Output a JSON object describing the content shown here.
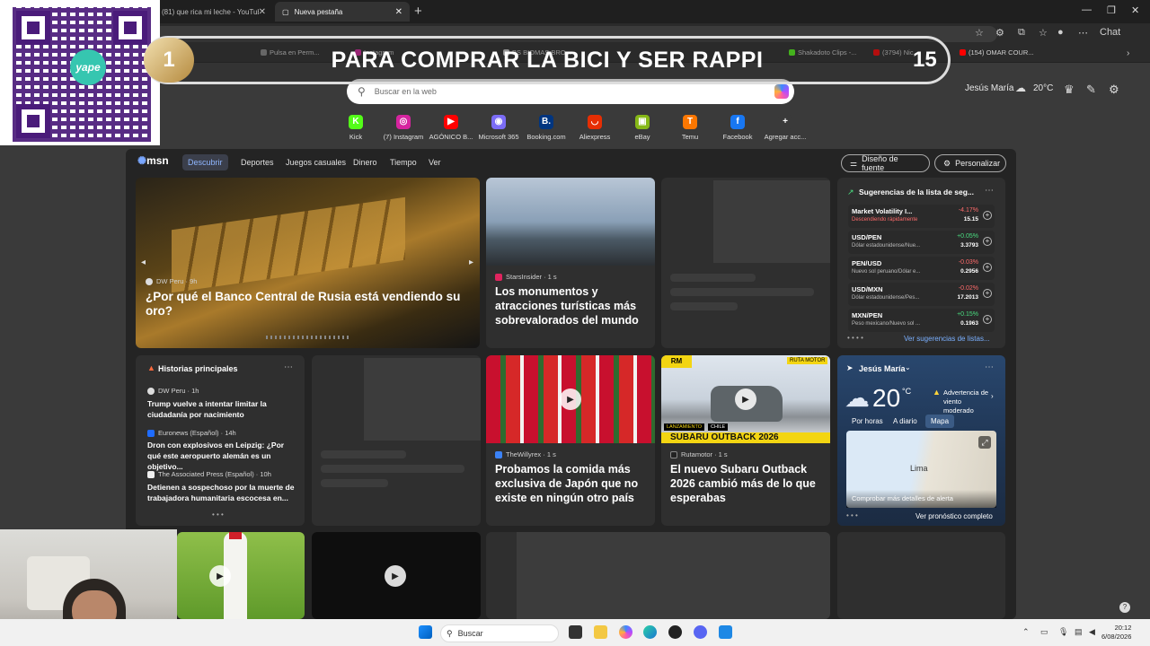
{
  "tabs": [
    {
      "label": "(81) que rica mi leche - YouTube",
      "active": false
    },
    {
      "label": "Nueva pestaña",
      "active": true
    }
  ],
  "favorites": [
    "Pulsa en Perm...",
    "Instagram",
    "BS BIOMAS BRO...",
    "Shakadoto Clips -...",
    "(3794) Nic...",
    "(154) OMAR COUR..."
  ],
  "overlay": {
    "banner_text": "PARA COMPRAR LA BICI Y SER RAPPI",
    "banner_left": "1",
    "banner_right": "15",
    "yape": "yape"
  },
  "search": {
    "placeholder": "Buscar en la web"
  },
  "header": {
    "location": "Jesús María",
    "temp": "20°C"
  },
  "quicklinks": [
    {
      "label": "Kick",
      "color": "#53fc18",
      "glyph": "K"
    },
    {
      "label": "(7) Instagram",
      "color": "#d6249f",
      "glyph": "◎"
    },
    {
      "label": "AGÓNICO B...",
      "color": "#ff0000",
      "glyph": "▶"
    },
    {
      "label": "Microsoft 365",
      "color": "#7b6cf6",
      "glyph": "◉"
    },
    {
      "label": "Booking.com",
      "color": "#003580",
      "glyph": "B."
    },
    {
      "label": "Aliexpress",
      "color": "#e62e04",
      "glyph": "◡"
    },
    {
      "label": "eBay",
      "color": "#86b817",
      "glyph": "▣"
    },
    {
      "label": "Temu",
      "color": "#fb7701",
      "glyph": "T"
    },
    {
      "label": "Facebook",
      "color": "#1877f2",
      "glyph": "f"
    },
    {
      "label": "Agregar acc...",
      "color": "#3a3a3a",
      "glyph": "+"
    }
  ],
  "msn": {
    "logo": "msn",
    "nav": [
      "Descubrir",
      "Deportes",
      "Juegos casuales",
      "Dinero",
      "Tiempo",
      "Ver"
    ],
    "design_btn": "Diseño de fuente",
    "personalize_btn": "Personalizar"
  },
  "hero": {
    "source": "DW Peru · 9h",
    "title": "¿Por qué el Banco Central de Rusia está vendiendo su oro?"
  },
  "card1": {
    "source": "StarsInsider · 1 s",
    "title": "Los monumentos y atracciones turísticas más sobrevalorados del mundo"
  },
  "watchlist": {
    "title": "Sugerencias de la lista de seg...",
    "items": [
      {
        "name": "Market Volatility I...",
        "sub": "Descendiendo rápidamente",
        "chg": "-4.17%",
        "val": "15.15"
      },
      {
        "name": "USD/PEN",
        "sub": "Dólar estadounidense/Nue...",
        "chg": "+0.05%",
        "val": "3.3793"
      },
      {
        "name": "PEN/USD",
        "sub": "Nuevo sol peruano/Dólar e...",
        "chg": "-0.03%",
        "val": "0.2956"
      },
      {
        "name": "USD/MXN",
        "sub": "Dólar estadounidense/Pes...",
        "chg": "-0.02%",
        "val": "17.2013"
      },
      {
        "name": "MXN/PEN",
        "sub": "Peso mexicano/Nuevo sol ...",
        "chg": "+0.15%",
        "val": "0.1963"
      }
    ],
    "more": "Ver sugerencias de listas..."
  },
  "top_stories": {
    "title": "Historias principales",
    "items": [
      {
        "source": "DW Peru · 1h",
        "title": "Trump vuelve a intentar limitar la ciudadanía por nacimiento"
      },
      {
        "source": "Euronews (Español) · 14h",
        "title": "Dron con explosivos en Leipzig: ¿Por qué este aeropuerto alemán es un objetivo..."
      },
      {
        "source": "The Associated Press (Español) · 10h",
        "title": "Detienen a sospechoso por la muerte de trabajadora humanitaria escocesa en..."
      }
    ]
  },
  "card2": {
    "source": "TheWillyrex · 1 s",
    "title": "Probamos la comida más exclusiva de Japón que no existe en ningún otro país"
  },
  "card3": {
    "source": "Rutamotor · 1 s",
    "title": "El nuevo Subaru Outback 2026 cambió más de lo que esperabas",
    "tag1": "RUTA MOTOR",
    "tag2": "LANZAMIENTO",
    "tag3": "CHILE",
    "overlay": "SUBARU OUTBACK 2026"
  },
  "weather": {
    "location": "Jesús María",
    "temp": "20",
    "unit": "°C",
    "alert": "Advertencia de viento moderado",
    "tabs": [
      "Por horas",
      "A diario",
      "Mapa"
    ],
    "map_label": "Lima",
    "more_alerts": "Comprobar más detalles de alerta",
    "forecast": "Ver pronóstico completo"
  },
  "taskbar": {
    "search": "Buscar",
    "time": "20:12",
    "date": "6/08/2026"
  },
  "misc": {
    "chat": "Chat"
  }
}
